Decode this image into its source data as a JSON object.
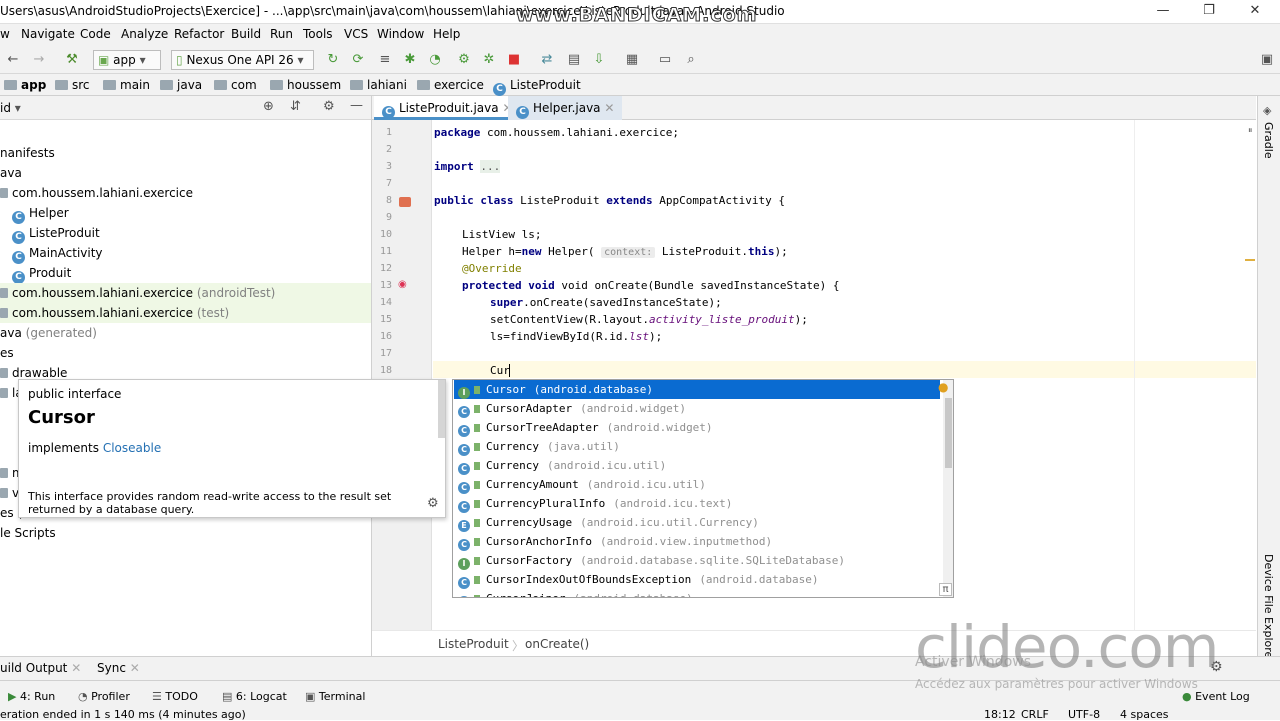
{
  "window": {
    "title": "Users\\asus\\AndroidStudioProjects\\Exercice] - ...\\app\\src\\main\\java\\com\\houssem\\lahiani\\exercice\\ListeProduit.java - Android Studio",
    "recorder_watermark": "www.BANDICAM.com",
    "controls": [
      "—",
      "❐",
      "✕"
    ]
  },
  "menu": [
    "w",
    "Navigate",
    "Code",
    "Analyze",
    "Refactor",
    "Build",
    "Run",
    "Tools",
    "VCS",
    "Window",
    "Help"
  ],
  "toolbar": {
    "module": "app",
    "device": "Nexus One API 26"
  },
  "breadcrumb": [
    "app",
    "src",
    "main",
    "java",
    "com",
    "houssem",
    "lahiani",
    "exercice",
    "ListeProduit"
  ],
  "project": {
    "header": "id",
    "tree": [
      {
        "label": "nanifests",
        "suffix": ""
      },
      {
        "label": "ava",
        "suffix": ""
      },
      {
        "label": "com.houssem.lahiani.exercice",
        "suffix": ""
      },
      {
        "label": "Helper",
        "suffix": ""
      },
      {
        "label": "ListeProduit",
        "suffix": ""
      },
      {
        "label": "MainActivity",
        "suffix": ""
      },
      {
        "label": "Produit",
        "suffix": ""
      },
      {
        "label": "com.houssem.lahiani.exercice",
        "suffix": "(androidTest)"
      },
      {
        "label": "com.houssem.lahiani.exercice",
        "suffix": "(test)"
      },
      {
        "label": "ava",
        "suffix": "(generated)"
      },
      {
        "label": "es",
        "suffix": ""
      },
      {
        "label": "drawable",
        "suffix": ""
      },
      {
        "label": "la",
        "suffix": ""
      },
      {
        "label": "m",
        "suffix": ""
      },
      {
        "label": "v",
        "suffix": ""
      },
      {
        "label": "es (",
        "suffix": ""
      },
      {
        "label": "le Scripts",
        "suffix": ""
      }
    ]
  },
  "tabs": [
    "ListeProduit.java",
    "Helper.java"
  ],
  "code": {
    "line_numbers": [
      "1",
      "2",
      "3",
      "7",
      "8",
      "9",
      "10",
      "11",
      "12",
      "13",
      "14",
      "15",
      "16",
      "17",
      "18"
    ],
    "package": "com.houssem.lahiani.exercice;",
    "import_fold": "...",
    "class_name": "ListeProduit",
    "superclass": "AppCompatActivity",
    "field1": "ListView ls;",
    "field2_start": "Helper h=",
    "field2_new": "new",
    "field2_ctor": " Helper(",
    "param_hint": "context:",
    "field2_end": " ListeProduit.",
    "this_kw": "this",
    "field2_close": ");",
    "override": "@Override",
    "method_sig": " void onCreate(Bundle savedInstanceState) {",
    "super_call": ".onCreate(savedInstanceState);",
    "set_content": "setContentView(R.layout.",
    "layout_name": "activity_liste_produit",
    "set_content_end": ");",
    "find_view": "ls=findViewById(R.id.",
    "id_name": "lst",
    "find_view_end": ");",
    "typed": "Cur"
  },
  "code_breadcrumb": [
    "ListeProduit",
    "onCreate()"
  ],
  "doc_popup": {
    "kind": "public interface",
    "name": "Cursor",
    "implements_label": "implements",
    "implements_link": "Closeable",
    "description_line1": "This interface provides random read-write access to the result set",
    "description_line2": "returned by a database query."
  },
  "completion": [
    {
      "icon": "I",
      "name": "Cursor",
      "pkg": "(android.database)"
    },
    {
      "icon": "C",
      "name": "CursorAdapter",
      "pkg": "(android.widget)"
    },
    {
      "icon": "C",
      "name": "CursorTreeAdapter",
      "pkg": "(android.widget)"
    },
    {
      "icon": "C",
      "name": "Currency",
      "pkg": "(java.util)"
    },
    {
      "icon": "C",
      "name": "Currency",
      "pkg": "(android.icu.util)"
    },
    {
      "icon": "C",
      "name": "CurrencyAmount",
      "pkg": "(android.icu.util)"
    },
    {
      "icon": "C",
      "name": "CurrencyPluralInfo",
      "pkg": "(android.icu.text)"
    },
    {
      "icon": "E",
      "name": "CurrencyUsage",
      "pkg": "(android.icu.util.Currency)"
    },
    {
      "icon": "C",
      "name": "CursorAnchorInfo",
      "pkg": "(android.view.inputmethod)"
    },
    {
      "icon": "I",
      "name": "CursorFactory",
      "pkg": "(android.database.sqlite.SQLiteDatabase)"
    },
    {
      "icon": "C",
      "name": "CursorIndexOutOfBoundsException",
      "pkg": "(android.database)"
    },
    {
      "icon": "C",
      "name": "CursorJoiner",
      "pkg": "(android.database)"
    }
  ],
  "completion_footer": "π",
  "bottom_tabs": [
    "uild Output",
    "Sync"
  ],
  "tool_windows": [
    "4: Run",
    "Profiler",
    "TODO",
    "6: Logcat",
    "Terminal",
    "Event Log"
  ],
  "status": {
    "message": "eration ended in 1 s 140 ms (4 minutes ago)",
    "position": "18:12",
    "line_sep": "CRLF",
    "encoding": "UTF-8",
    "indent": "4 spaces"
  },
  "right_tools": [
    "Gradle",
    "Device File Explorer"
  ],
  "overlay": {
    "clideo": "clideo.com",
    "activate1": "Activer Windows",
    "activate2": "Accédez aux paramètres pour activer Windows"
  }
}
